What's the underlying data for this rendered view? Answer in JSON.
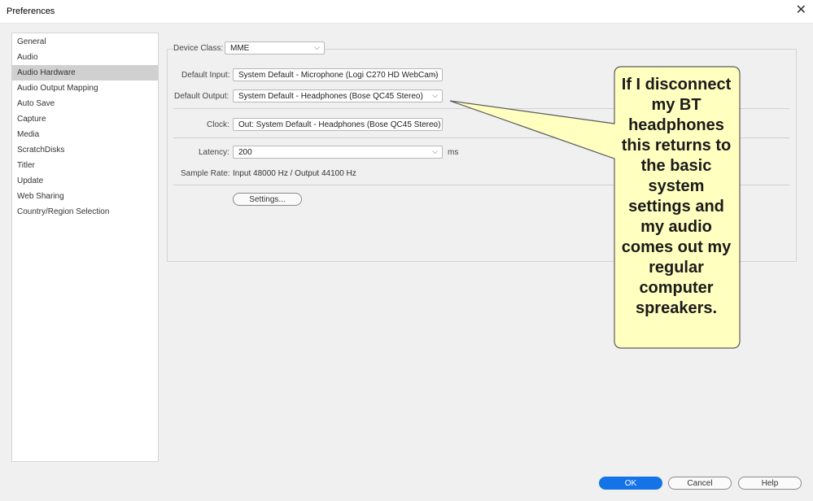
{
  "window": {
    "title": "Preferences"
  },
  "sidebar": {
    "items": [
      {
        "label": "General"
      },
      {
        "label": "Audio"
      },
      {
        "label": "Audio Hardware"
      },
      {
        "label": "Audio Output Mapping"
      },
      {
        "label": "Auto Save"
      },
      {
        "label": "Capture"
      },
      {
        "label": "Media"
      },
      {
        "label": "ScratchDisks"
      },
      {
        "label": "Titler"
      },
      {
        "label": "Update"
      },
      {
        "label": "Web Sharing"
      },
      {
        "label": "Country/Region Selection"
      }
    ],
    "selected": "Audio Hardware"
  },
  "audio_hardware": {
    "device_class_label": "Device Class:",
    "device_class_value": "MME",
    "default_input_label": "Default Input:",
    "default_input_value": "System Default - Microphone (Logi C270 HD WebCam)",
    "default_output_label": "Default Output:",
    "default_output_value": "System Default - Headphones (Bose QC45 Stereo)",
    "clock_label": "Clock:",
    "clock_value": "Out: System Default - Headphones (Bose QC45 Stereo)",
    "latency_label": "Latency:",
    "latency_value": "200",
    "latency_unit": "ms",
    "sample_rate_label": "Sample Rate:",
    "sample_rate_value": "Input 48000 Hz / Output 44100 Hz",
    "settings_button": "Settings..."
  },
  "footer": {
    "ok": "OK",
    "cancel": "Cancel",
    "help": "Help"
  },
  "callout": {
    "text": "If I disconnect my BT headphones this returns to the basic system settings and my audio comes out my regular computer spreakers.",
    "fill": "#ffffc0"
  },
  "icons": {
    "close": "close-icon",
    "chevron": "chevron-down-icon"
  },
  "colors": {
    "accent": "#1473e6",
    "selected_bg": "#d0d0d0"
  }
}
